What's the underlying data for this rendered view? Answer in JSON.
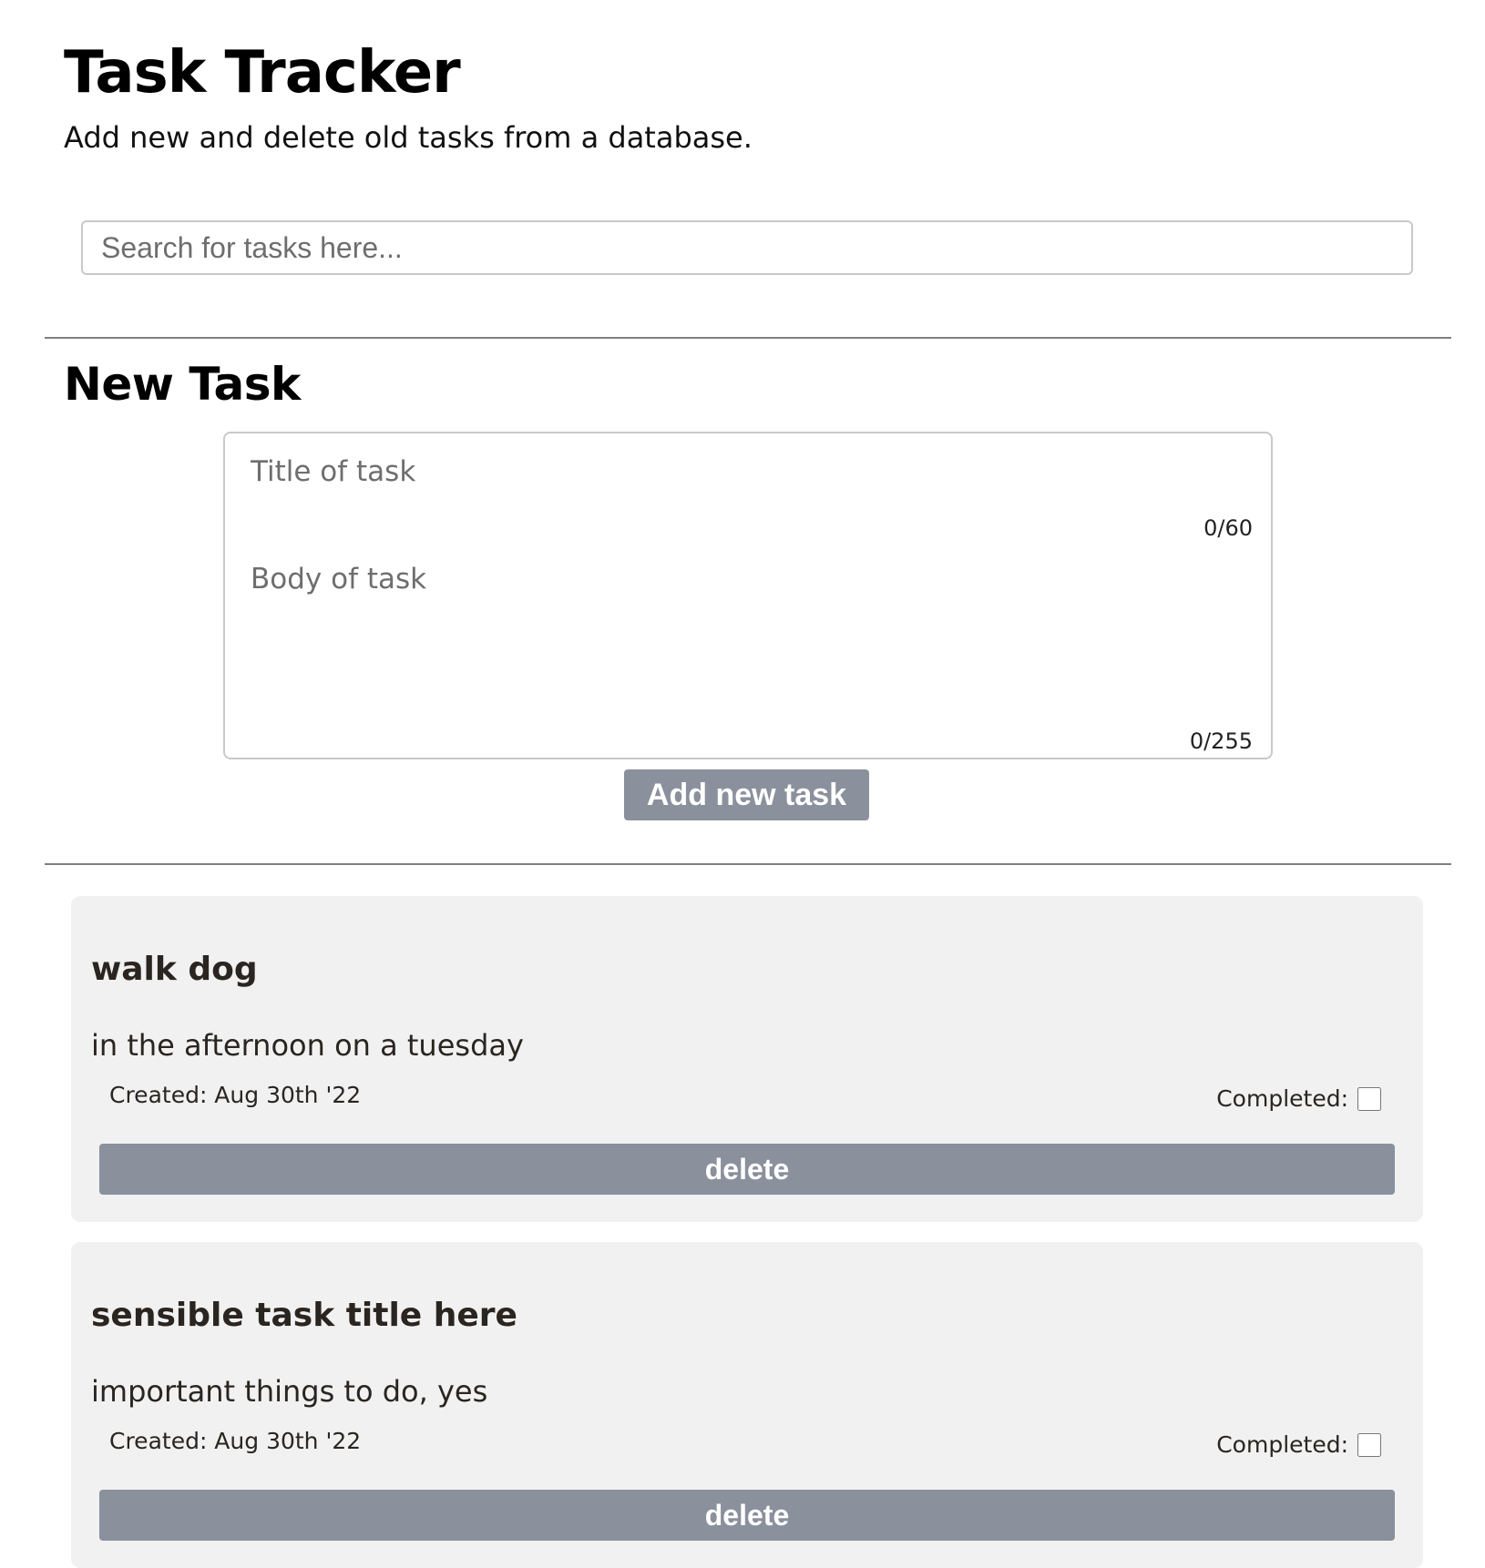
{
  "header": {
    "title": "Task Tracker",
    "subtitle": "Add new and delete old tasks from a database."
  },
  "search": {
    "placeholder": "Search for tasks here...",
    "value": ""
  },
  "new_task": {
    "heading": "New Task",
    "title_placeholder": "Title of task",
    "title_value": "",
    "title_counter": "0/60",
    "body_placeholder": "Body of task",
    "body_value": "",
    "body_counter": "0/255",
    "add_label": "Add new task"
  },
  "tasks": [
    {
      "title": "walk dog",
      "body": "in the afternoon on a tuesday",
      "created": "Created: Aug 30th '22",
      "completed_label": "Completed:",
      "completed": false,
      "delete_label": "delete"
    },
    {
      "title": "sensible task title here",
      "body": "important things to do, yes",
      "created": "Created: Aug 30th '22",
      "completed_label": "Completed:",
      "completed": false,
      "delete_label": "delete"
    }
  ],
  "colors": {
    "button_bg": "#8a909c",
    "card_bg": "#f1f1f1",
    "divider": "#7f7f7f"
  }
}
